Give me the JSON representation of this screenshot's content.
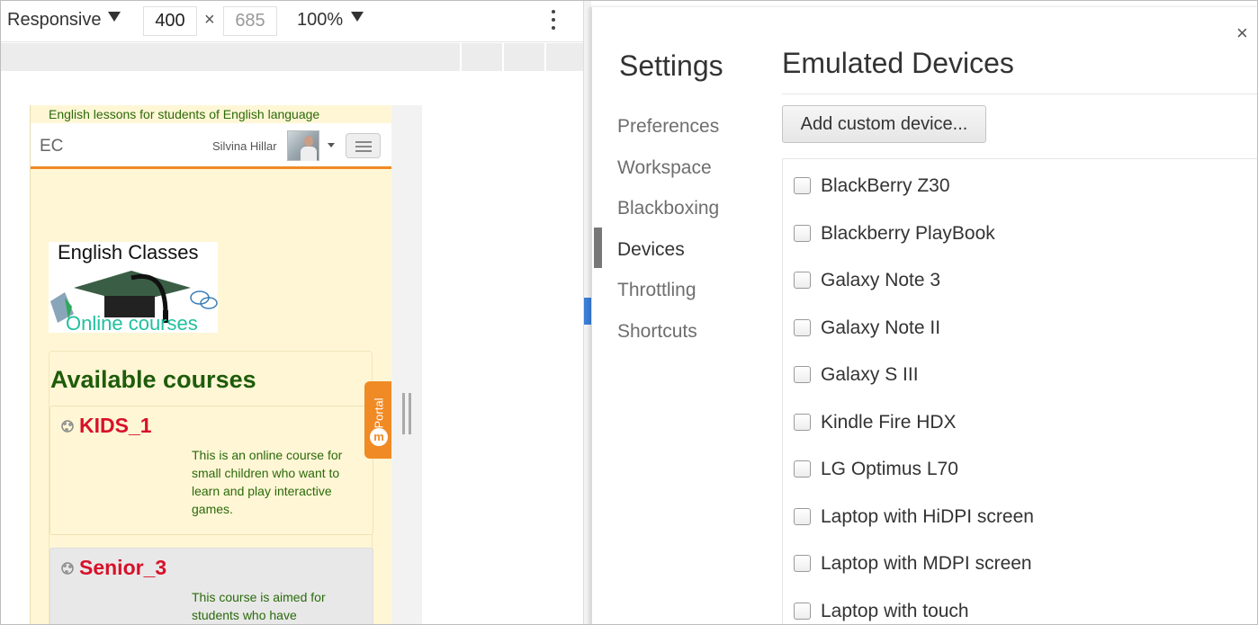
{
  "device_toolbar": {
    "mode": "Responsive",
    "width": "400",
    "times": "×",
    "height": "685",
    "zoom": "100%"
  },
  "mobile_page": {
    "tagline": "English lessons for students of English language",
    "brand": "EC",
    "user_name": "Silvina Hillar",
    "logo_title": "English Classes",
    "logo_subtitle": "Online courses",
    "courses_heading": "Available courses",
    "courses": [
      {
        "title": "KIDS_1",
        "description": "This is an online course for small children who want to learn and play interactive games."
      },
      {
        "title": "Senior_3",
        "description": "This course is aimed for students who have"
      }
    ],
    "portal_label": "Portal",
    "portal_icon_letter": "m"
  },
  "settings": {
    "title": "Settings",
    "close": "×",
    "nav": [
      "Preferences",
      "Workspace",
      "Blackboxing",
      "Devices",
      "Throttling",
      "Shortcuts"
    ],
    "active_nav": "Devices",
    "section_title": "Emulated Devices",
    "add_button": "Add custom device...",
    "devices": [
      "BlackBerry Z30",
      "Blackberry PlayBook",
      "Galaxy Note 3",
      "Galaxy Note II",
      "Galaxy S III",
      "Kindle Fire HDX",
      "LG Optimus L70",
      "Laptop with HiDPI screen",
      "Laptop with MDPI screen",
      "Laptop with touch"
    ]
  },
  "colors": {
    "accent_orange": "#f08a24",
    "course_title_red": "#d8102a",
    "heading_green": "#1e5c0a",
    "page_bg_cream": "#fff6d5"
  }
}
